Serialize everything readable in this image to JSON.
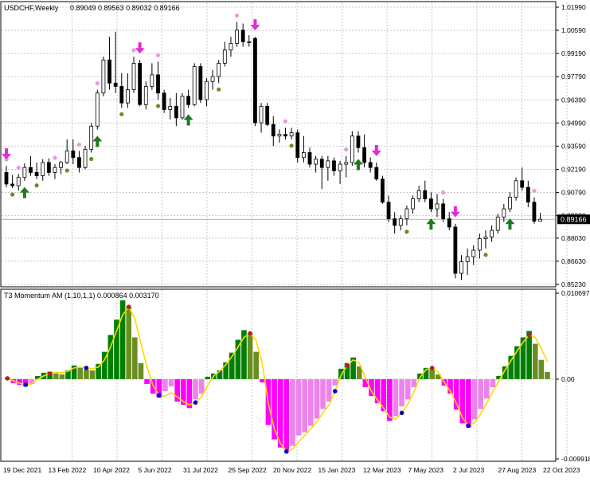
{
  "main": {
    "symbol_label": "USDCHF,Weekly",
    "ohlc_text": "0.89049 0.89563 0.89032 0.89166",
    "price_ticks": [
      "1.01990",
      "1.00590",
      "0.99190",
      "0.97790",
      "0.96390",
      "0.94990",
      "0.93590",
      "0.92190",
      "0.90790",
      "0.89390",
      "0.88030",
      "0.86630",
      "0.85230"
    ],
    "current_price": "0.89166"
  },
  "indicator": {
    "label": "T3 Momentum AM (1,10,1,1) 0.000864 0.003170",
    "ticks": [
      "0.010697",
      "0.00",
      "-0.009918"
    ]
  },
  "date_ticks": [
    "19 Dec 2021",
    "13 Feb 2022",
    "10 Apr 2022",
    "5 Jun 2022",
    "31 Jul 2022",
    "25 Sep 2022",
    "20 Nov 2022",
    "15 Jan 2023",
    "12 Mar 2023",
    "7 May 2023",
    "2 Jul 2023",
    "27 Aug 2023",
    "22 Oct 2023"
  ],
  "colors": {
    "bull_candle": "#ffffff",
    "bear_candle": "#000000",
    "grid": "#c8c8c8",
    "arrow_up": "#1f7a1f",
    "arrow_down": "#e62ad6",
    "dot_high": "#e89ae0",
    "dot_low": "#6b8e23",
    "hist_green": "#008000",
    "hist_olive": "#6b8e23",
    "hist_magenta": "#ff00ff",
    "hist_pink": "#ee82ee",
    "line": "#ffd700",
    "dot_red": "#b22222",
    "dot_blue": "#0000cd",
    "price_box": "#000000"
  },
  "chart_data": {
    "type": "candlestick",
    "instrument": "USDCHF",
    "timeframe": "Weekly",
    "candles": [
      [
        0.92,
        0.924,
        0.911,
        0.913
      ],
      [
        0.913,
        0.9185,
        0.9105,
        0.912
      ],
      [
        0.912,
        0.919,
        0.909,
        0.917
      ],
      [
        0.917,
        0.9255,
        0.915,
        0.923
      ],
      [
        0.923,
        0.93,
        0.918,
        0.92
      ],
      [
        0.92,
        0.926,
        0.916,
        0.918
      ],
      [
        0.918,
        0.928,
        0.915,
        0.926
      ],
      [
        0.926,
        0.9285,
        0.918,
        0.92
      ],
      [
        0.92,
        0.925,
        0.916,
        0.923
      ],
      [
        0.923,
        0.927,
        0.919,
        0.926
      ],
      [
        0.926,
        0.94,
        0.925,
        0.933
      ],
      [
        0.933,
        0.94,
        0.925,
        0.929
      ],
      [
        0.929,
        0.933,
        0.92,
        0.923
      ],
      [
        0.923,
        0.936,
        0.922,
        0.934
      ],
      [
        0.934,
        0.95,
        0.932,
        0.948
      ],
      [
        0.948,
        0.97,
        0.946,
        0.968
      ],
      [
        0.968,
        0.99,
        0.966,
        0.988
      ],
      [
        0.988,
        1.002,
        0.97,
        0.974
      ],
      [
        0.974,
        1.005,
        0.968,
        0.972
      ],
      [
        0.972,
        0.98,
        0.959,
        0.962
      ],
      [
        0.962,
        0.98,
        0.959,
        0.97
      ],
      [
        0.97,
        0.99,
        0.968,
        0.986
      ],
      [
        0.986,
        0.988,
        0.96,
        0.961
      ],
      [
        0.961,
        0.975,
        0.958,
        0.972
      ],
      [
        0.972,
        0.986,
        0.97,
        0.979
      ],
      [
        0.979,
        0.987,
        0.964,
        0.968
      ],
      [
        0.968,
        0.97,
        0.956,
        0.958
      ],
      [
        0.958,
        0.965,
        0.952,
        0.96
      ],
      [
        0.96,
        0.968,
        0.948,
        0.953
      ],
      [
        0.953,
        0.968,
        0.952,
        0.966
      ],
      [
        0.966,
        0.97,
        0.959,
        0.961
      ],
      [
        0.961,
        0.986,
        0.96,
        0.984
      ],
      [
        0.984,
        0.986,
        0.962,
        0.964
      ],
      [
        0.964,
        0.977,
        0.96,
        0.975
      ],
      [
        0.975,
        0.982,
        0.97,
        0.978
      ],
      [
        0.978,
        0.988,
        0.974,
        0.986
      ],
      [
        0.986,
        0.999,
        0.984,
        0.994
      ],
      [
        0.994,
        1.002,
        0.99,
        0.998
      ],
      [
        0.998,
        1.011,
        0.996,
        1.006
      ],
      [
        1.006,
        1.01,
        0.996,
        0.999
      ],
      [
        0.999,
        1.003,
        0.996,
        0.999
      ],
      [
        1.001,
        1.002,
        0.948,
        0.95
      ],
      [
        0.95,
        0.962,
        0.944,
        0.96
      ],
      [
        0.96,
        0.962,
        0.948,
        0.949
      ],
      [
        0.949,
        0.954,
        0.936,
        0.942
      ],
      [
        0.942,
        0.946,
        0.938,
        0.943
      ],
      [
        0.943,
        0.947,
        0.94,
        0.942
      ],
      [
        0.942,
        0.947,
        0.94,
        0.944
      ],
      [
        0.944,
        0.946,
        0.926,
        0.929
      ],
      [
        0.929,
        0.942,
        0.926,
        0.932
      ],
      [
        0.932,
        0.935,
        0.923,
        0.925
      ],
      [
        0.925,
        0.93,
        0.92,
        0.928
      ],
      [
        0.928,
        0.93,
        0.91,
        0.923
      ],
      [
        0.923,
        0.93,
        0.915,
        0.927
      ],
      [
        0.927,
        0.929,
        0.918,
        0.921
      ],
      [
        0.921,
        0.927,
        0.913,
        0.925
      ],
      [
        0.925,
        0.93,
        0.917,
        0.926
      ],
      [
        0.926,
        0.945,
        0.924,
        0.942
      ],
      [
        0.942,
        0.945,
        0.932,
        0.935
      ],
      [
        0.935,
        0.943,
        0.923,
        0.926
      ],
      [
        0.926,
        0.929,
        0.92,
        0.923
      ],
      [
        0.923,
        0.926,
        0.915,
        0.916
      ],
      [
        0.916,
        0.918,
        0.901,
        0.902
      ],
      [
        0.902,
        0.906,
        0.89,
        0.892
      ],
      [
        0.892,
        0.896,
        0.883,
        0.888
      ],
      [
        0.888,
        0.894,
        0.885,
        0.892
      ],
      [
        0.892,
        0.9,
        0.888,
        0.898
      ],
      [
        0.898,
        0.906,
        0.895,
        0.904
      ],
      [
        0.904,
        0.912,
        0.902,
        0.909
      ],
      [
        0.909,
        0.915,
        0.902,
        0.904
      ],
      [
        0.904,
        0.908,
        0.896,
        0.898
      ],
      [
        0.898,
        0.907,
        0.893,
        0.901
      ],
      [
        0.901,
        0.904,
        0.89,
        0.892
      ],
      [
        0.892,
        0.896,
        0.885,
        0.887
      ],
      [
        0.887,
        0.889,
        0.856,
        0.859
      ],
      [
        0.859,
        0.87,
        0.855,
        0.866
      ],
      [
        0.866,
        0.874,
        0.858,
        0.869
      ],
      [
        0.869,
        0.876,
        0.864,
        0.873
      ],
      [
        0.873,
        0.883,
        0.868,
        0.88
      ],
      [
        0.88,
        0.885,
        0.874,
        0.881
      ],
      [
        0.881,
        0.888,
        0.878,
        0.885
      ],
      [
        0.885,
        0.895,
        0.883,
        0.893
      ],
      [
        0.893,
        0.901,
        0.89,
        0.898
      ],
      [
        0.898,
        0.908,
        0.896,
        0.905
      ],
      [
        0.905,
        0.917,
        0.903,
        0.915
      ],
      [
        0.915,
        0.923,
        0.909,
        0.911
      ],
      [
        0.911,
        0.915,
        0.899,
        0.902
      ],
      [
        0.902,
        0.905,
        0.889,
        0.8905
      ],
      [
        0.8905,
        0.8956,
        0.8903,
        0.8917
      ]
    ],
    "arrows_up": [
      3,
      15,
      30,
      58,
      70,
      83
    ],
    "arrows_down": [
      0,
      22,
      41,
      61,
      74
    ],
    "dots_high": [
      0,
      2,
      8,
      12,
      15,
      21,
      25,
      38,
      46,
      56,
      72,
      87
    ],
    "dots_low": [
      1,
      5,
      10,
      14,
      19,
      25,
      35,
      47,
      66,
      79
    ],
    "price_range": [
      0.8523,
      1.0199
    ],
    "current_price": 0.89166,
    "indicator": {
      "name": "T3 Momentum AM",
      "params": "(1,10,1,1)",
      "values_shown": [
        0.000864,
        0.00317
      ],
      "range": [
        -0.009918,
        0.010697
      ],
      "histogram": [
        0.0002,
        -0.0005,
        -0.0007,
        -0.0009,
        -0.0006,
        0.0004,
        0.0008,
        0.0009,
        0.0007,
        0.0006,
        0.0011,
        0.0017,
        0.0014,
        0.0012,
        0.0011,
        0.0019,
        0.0034,
        0.0055,
        0.0074,
        0.0098,
        0.009,
        0.0052,
        0.002,
        -0.0006,
        -0.0018,
        -0.0023,
        -0.0015,
        -0.0009,
        -0.0028,
        -0.0032,
        -0.0036,
        -0.0025,
        -0.0018,
        0.0003,
        0.0007,
        0.0011,
        0.0021,
        0.0033,
        0.0049,
        0.0061,
        0.0057,
        0.0034,
        -0.0004,
        -0.0057,
        -0.0075,
        -0.0085,
        -0.0088,
        -0.0083,
        -0.007,
        -0.0066,
        -0.0058,
        -0.0049,
        -0.0037,
        -0.0028,
        -0.0008,
        0.0013,
        0.002,
        0.0027,
        0.0016,
        -0.001,
        -0.0021,
        -0.003,
        -0.004,
        -0.0052,
        -0.0046,
        -0.0034,
        -0.0025,
        -0.001,
        0.0007,
        0.0014,
        0.0013,
        0.0006,
        -0.0008,
        -0.0018,
        -0.0038,
        -0.0055,
        -0.006,
        -0.005,
        -0.0037,
        -0.0024,
        -0.001,
        0.0004,
        0.0016,
        0.0029,
        0.0041,
        0.0052,
        0.006,
        0.0044,
        0.0024,
        0.0009
      ],
      "signal_line": [
        0.0001,
        -0.0002,
        -0.0005,
        -0.0007,
        -0.0006,
        0.0,
        0.0004,
        0.0007,
        0.0008,
        0.0008,
        0.001,
        0.0014,
        0.0015,
        0.0014,
        0.0013,
        0.0015,
        0.0024,
        0.004,
        0.006,
        0.008,
        0.009,
        0.0075,
        0.0045,
        0.0015,
        -0.0008,
        -0.002,
        -0.0021,
        -0.0017,
        -0.0022,
        -0.0028,
        -0.0032,
        -0.0029,
        -0.0022,
        -0.0008,
        0.0004,
        0.001,
        0.0018,
        0.0028,
        0.004,
        0.0052,
        0.0057,
        0.0048,
        0.002,
        -0.003,
        -0.0062,
        -0.008,
        -0.009,
        -0.0087,
        -0.0078,
        -0.007,
        -0.0062,
        -0.0053,
        -0.0042,
        -0.0032,
        -0.0015,
        0.0005,
        0.0017,
        0.0024,
        0.002,
        0.0002,
        -0.0015,
        -0.0026,
        -0.0036,
        -0.0047,
        -0.005,
        -0.0042,
        -0.0031,
        -0.0016,
        0.0002,
        0.0012,
        0.0014,
        0.0009,
        -0.0004,
        -0.0015,
        -0.003,
        -0.0048,
        -0.0058,
        -0.0054,
        -0.0043,
        -0.003,
        -0.0016,
        -0.0002,
        0.0011,
        0.0023,
        0.0035,
        0.0046,
        0.0055,
        0.0052,
        0.0038,
        0.0022
      ],
      "red_dots": [
        0,
        7,
        20,
        40,
        56,
        70,
        86
      ],
      "blue_dots": [
        3,
        13,
        25,
        31,
        46,
        54,
        65,
        76
      ],
      "dots_line_offset": true
    }
  }
}
